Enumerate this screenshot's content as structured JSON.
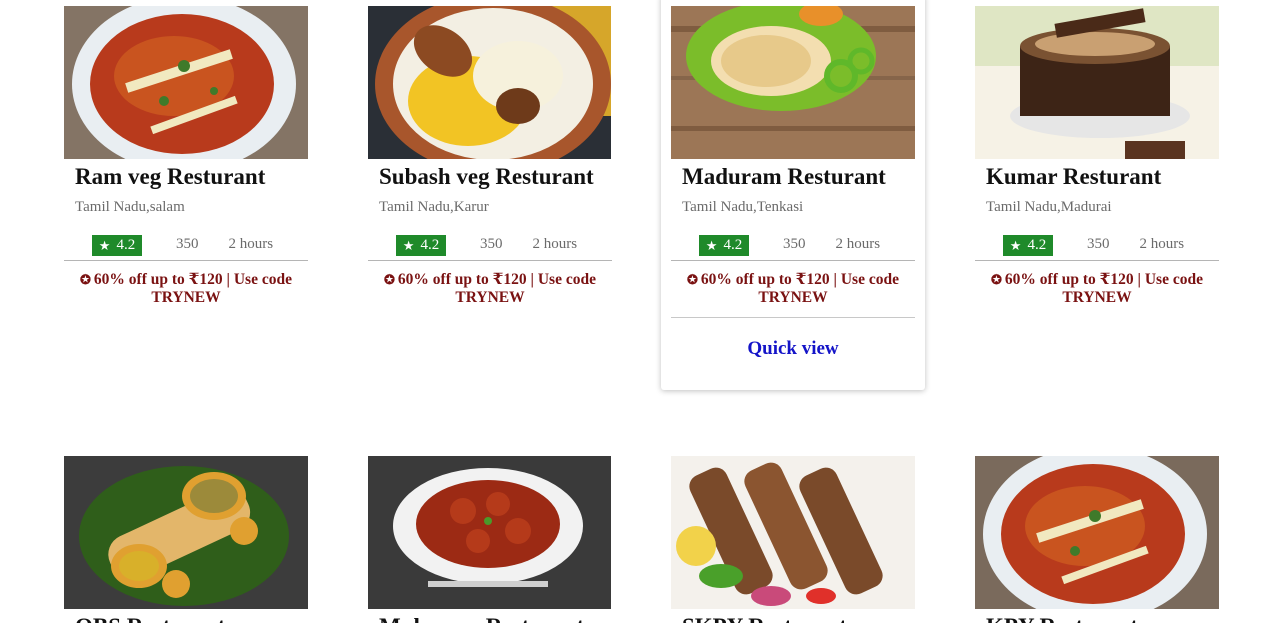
{
  "restaurants": [
    {
      "name": "Ram veg Resturant",
      "location": "Tamil Nadu,salam",
      "rating": "4.2",
      "price": "350",
      "time": "2 hours",
      "offer": "60% off up to ₹120 | Use code TRYNEW",
      "image": "soup-bowl"
    },
    {
      "name": "Subash veg Resturant",
      "location": "Tamil Nadu,Karur",
      "rating": "4.2",
      "price": "350",
      "time": "2 hours",
      "offer": "60% off up to ₹120 | Use code TRYNEW",
      "image": "biryani"
    },
    {
      "name": "Maduram Resturant",
      "location": "Tamil Nadu,Tenkasi",
      "rating": "4.2",
      "price": "350",
      "time": "2 hours",
      "offer": "60% off up to ₹120 | Use code TRYNEW",
      "image": "paratha-thali",
      "quick_view": "Quick view"
    },
    {
      "name": "Kumar Resturant",
      "location": "Tamil Nadu,Madurai",
      "rating": "4.2",
      "price": "350",
      "time": "2 hours",
      "offer": "60% off up to ₹120 | Use code TRYNEW",
      "image": "chocolate-cake"
    },
    {
      "name": "OBS Resturant",
      "image": "dosa-platter"
    },
    {
      "name": "Muhuram Resturant",
      "image": "chilli-chicken"
    },
    {
      "name": "SKPY Resturant",
      "image": "kebab-skewers"
    },
    {
      "name": "KPY Resturant",
      "image": "soup-bowl"
    }
  ],
  "colors": {
    "rating_bg": "#1f8a2a",
    "offer_text": "#7a1212",
    "quick_view": "#1414c8"
  },
  "icons": {
    "rating": "star-icon",
    "offer": "discount-badge-icon"
  }
}
